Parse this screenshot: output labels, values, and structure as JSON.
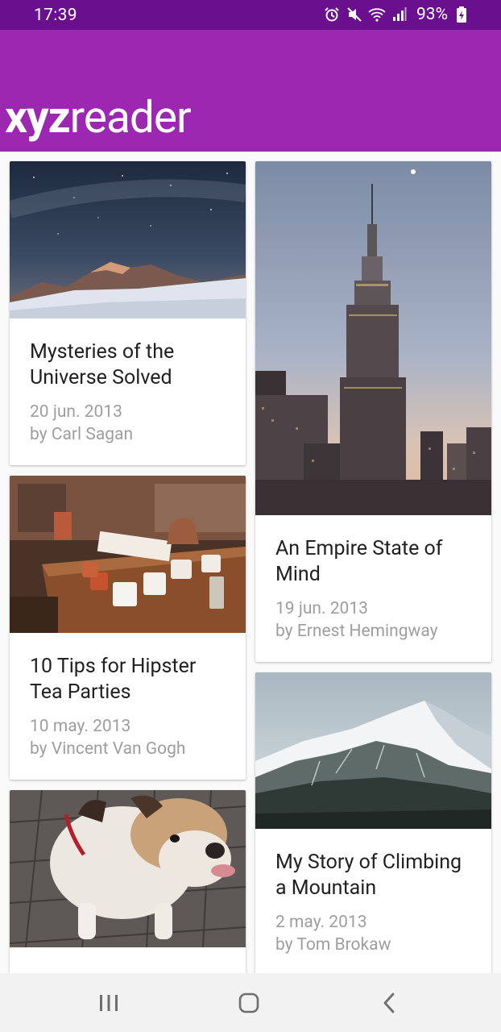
{
  "status_bar": {
    "time": "17:39",
    "battery": "93%",
    "icons": [
      "alarm-icon",
      "mute-icon",
      "wifi-icon",
      "signal-icon",
      "battery-charging-icon"
    ]
  },
  "app_bar": {
    "logo_bold": "xyz",
    "logo_light": "reader",
    "color": "#9c27b0",
    "status_color": "#6a0f8e"
  },
  "articles": [
    {
      "title": "Mysteries of the Universe Solved",
      "date": "20 jun. 2013",
      "author": "by Carl Sagan",
      "image": "starry-mountain-image"
    },
    {
      "title": "An Empire State of Mind",
      "date": "19 jun. 2013",
      "author": "by Ernest Hemingway",
      "image": "empire-state-building-image"
    },
    {
      "title": "10 Tips for Hipster Tea Parties",
      "date": "10 may. 2013",
      "author": "by Vincent Van Gogh",
      "image": "tea-cups-table-image"
    },
    {
      "title": "My Story of Climbing a Mountain",
      "date": "2 may. 2013",
      "author": "by Tom Brokaw",
      "image": "snowy-mountain-image"
    },
    {
      "image": "bulldog-image"
    }
  ],
  "nav_bar": {
    "buttons": [
      "recents-button",
      "home-button",
      "back-button"
    ]
  }
}
